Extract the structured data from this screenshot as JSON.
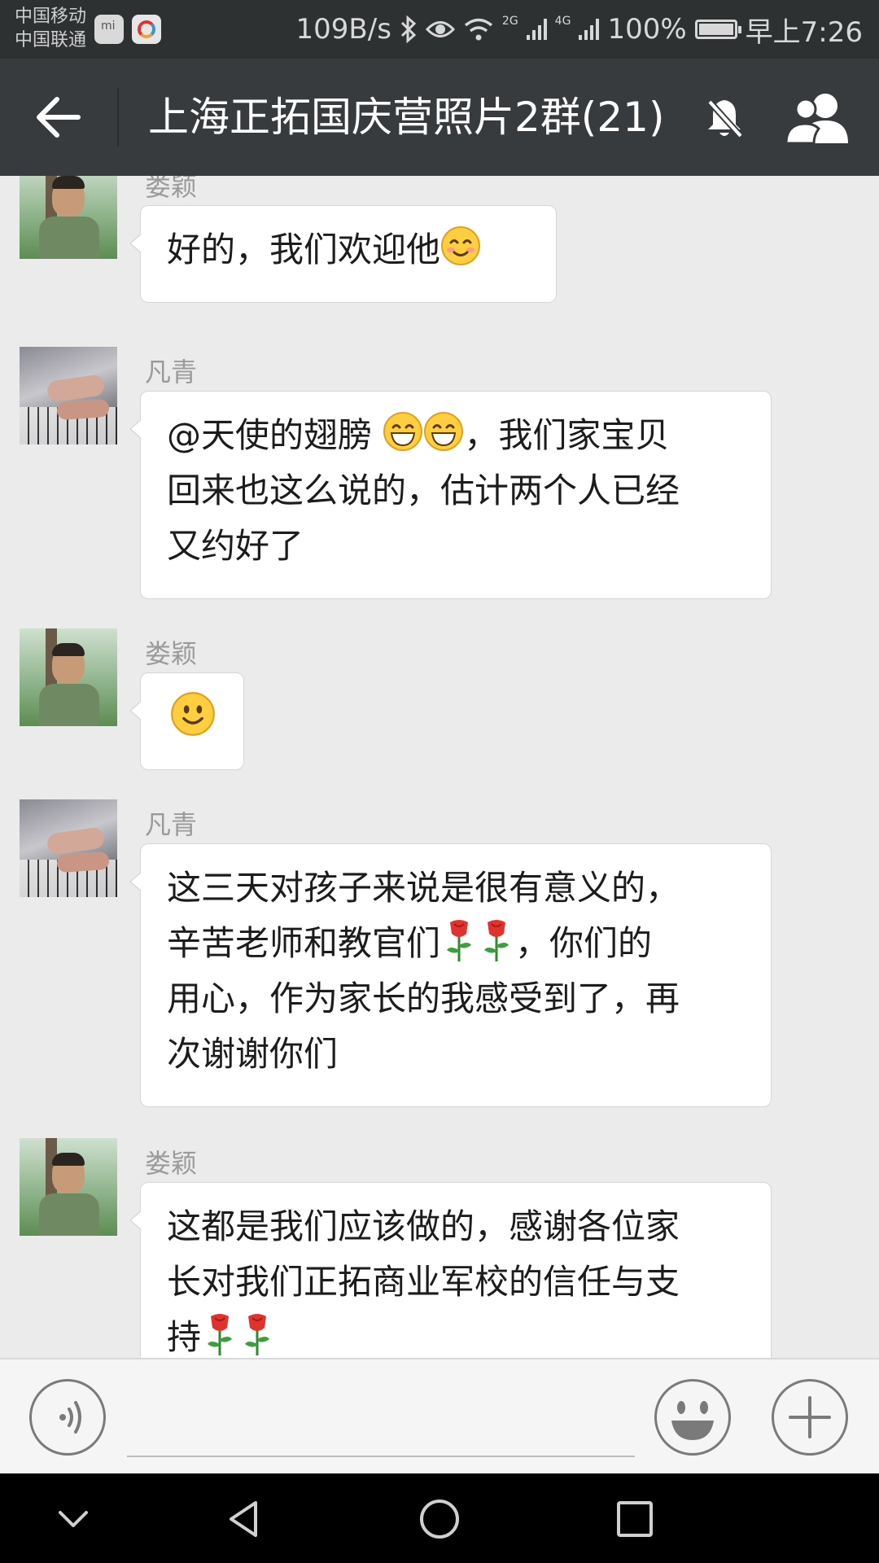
{
  "status_bar": {
    "carrier_1": "中国移动",
    "carrier_2": "中国联通",
    "net_speed": "109B/s",
    "net_2g": "2G",
    "net_4g": "4G",
    "battery": "100%",
    "time": "早上7:26"
  },
  "title_bar": {
    "title": "上海正拓国庆营照片2群(21)",
    "back_icon": "arrow-left-icon",
    "mute_icon": "bell-off-icon",
    "members_icon": "people-icon"
  },
  "messages": [
    {
      "sender": "娄颖",
      "avatar": "soldier",
      "text": "好的，我们欢迎他",
      "emoji_suffix": "blush-emoji"
    },
    {
      "sender": "凡青",
      "avatar": "piano",
      "line1_pre": "@天使的翅膀 ",
      "line1_post": "，我们家宝贝",
      "line2": "回来也这么说的，估计两个人已经",
      "line3": "又约好了"
    },
    {
      "sender": "娄颖",
      "avatar": "soldier",
      "emoji": "smile-emoji"
    },
    {
      "sender": "凡青",
      "avatar": "piano",
      "line1": "这三天对孩子来说是很有意义的，",
      "line2_pre": "辛苦老师和教官们",
      "line2_post": "，你们的",
      "line3": "用心，作为家长的我感受到了，再",
      "line4": "次谢谢你们"
    },
    {
      "sender": "娄颖",
      "avatar": "soldier",
      "line1": "这都是我们应该做的，感谢各位家",
      "line2": "长对我们正拓商业军校的信任与支",
      "line3": "持"
    }
  ],
  "input_bar": {
    "voice_icon": "voice-icon",
    "emoji_icon": "emoji-face-icon",
    "plus_icon": "plus-icon",
    "input_value": ""
  },
  "nav_bar": {
    "icons": [
      "chevron-down-icon",
      "back-triangle-icon",
      "home-circle-icon",
      "recents-square-icon"
    ]
  },
  "colors": {
    "status_bg": "#2e3132",
    "title_bg": "#383b3d",
    "chat_bg": "#ebebeb",
    "bubble_bg": "#ffffff"
  }
}
